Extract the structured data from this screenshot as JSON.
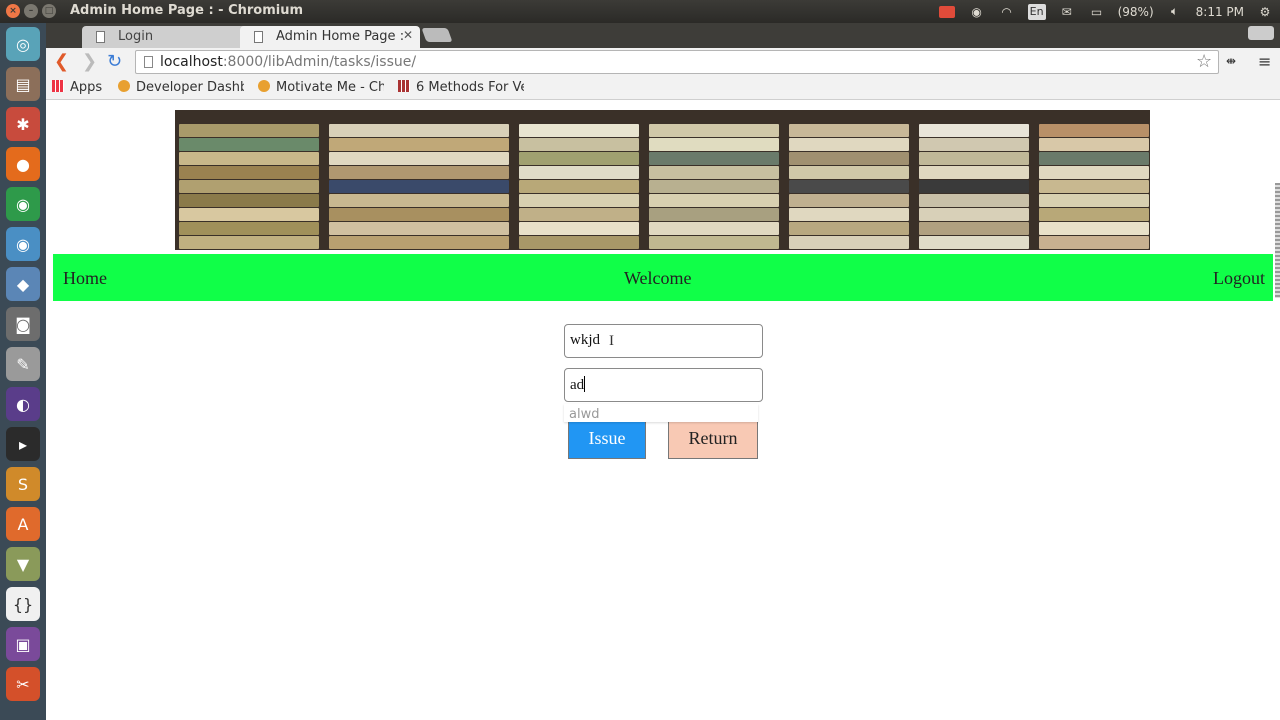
{
  "window": {
    "title": "Admin Home Page : - Chromium"
  },
  "system_tray": {
    "keyboard": "En",
    "battery": "(98%)",
    "time": "8:11 PM",
    "icons": [
      "record-icon",
      "chrome-sync-icon",
      "wifi-icon",
      "keyboard-icon",
      "mail-icon",
      "battery-icon",
      "volume-icon",
      "settings-icon"
    ]
  },
  "launcher": {
    "icons": [
      "dash-icon",
      "files-icon",
      "settings-icon",
      "firefox-icon",
      "chrome-icon",
      "chromium-icon",
      "cube-icon",
      "camera-icon",
      "text-editor-icon",
      "eclipse-icon",
      "terminal-icon",
      "sublime-icon",
      "software-center-icon",
      "archive-icon",
      "brackets-icon",
      "media-icon",
      "tools-icon"
    ]
  },
  "tabs": [
    {
      "title": "Login",
      "active": false
    },
    {
      "title": "Admin Home Page :",
      "active": true
    }
  ],
  "address_bar": {
    "host": "localhost",
    "rest": ":8000/libAdmin/tasks/issue/"
  },
  "bookmarks": [
    {
      "label": "Apps"
    },
    {
      "label": "Developer Dashb"
    },
    {
      "label": "Motivate Me - Ch"
    },
    {
      "label": "6 Methods For Ve"
    }
  ],
  "nav": {
    "home": "Home",
    "welcome": "Welcome",
    "logout": "Logout"
  },
  "form": {
    "field1_value": "wkjd",
    "field2_value": "ad",
    "autocomplete_suggestion": "alwd",
    "issue_label": "Issue",
    "return_label": "Return"
  },
  "colors": {
    "nav_bg": "#10ff48",
    "issue_bg": "#2196f3",
    "return_bg": "#f8c9b4"
  }
}
